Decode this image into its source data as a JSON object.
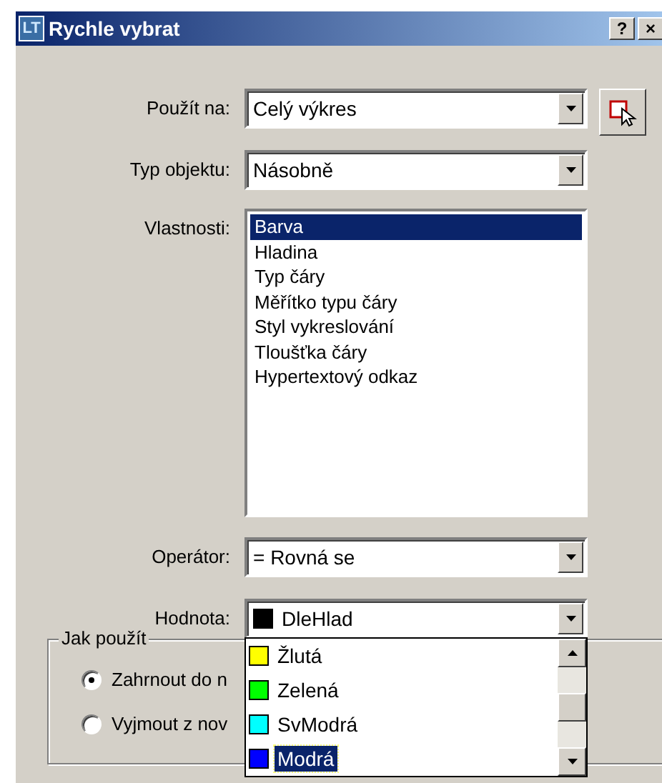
{
  "window": {
    "icon_text": "LT",
    "title": "Rychle vybrat",
    "title_buttons": [
      "?",
      "×"
    ]
  },
  "fields": [
    {
      "kind": "combo",
      "label": "Použít na:",
      "value": "Celý výkres",
      "pick_button": true
    },
    {
      "kind": "combo",
      "label": "Typ objektu:",
      "value": "Násobně"
    },
    {
      "kind": "list",
      "label": "Vlastnosti:",
      "items": [
        {
          "text": "Barva",
          "selected": true
        },
        {
          "text": "Hladina",
          "selected": false
        },
        {
          "text": "Typ čáry",
          "selected": false
        },
        {
          "text": "Měřítko typu čáry",
          "selected": false
        },
        {
          "text": "Styl vykreslování",
          "selected": false
        },
        {
          "text": "Tloušťka čáry",
          "selected": false
        },
        {
          "text": "Hypertextový odkaz",
          "selected": false
        }
      ]
    },
    {
      "kind": "combo",
      "label": "Operátor:",
      "value": "= Rovná se"
    },
    {
      "kind": "color_combo",
      "label": "Hodnota:",
      "value": "DleHlad",
      "color": "#000000",
      "options": [
        {
          "text": "Žlutá",
          "color": "#ffff00",
          "selected": false
        },
        {
          "text": "Zelená",
          "color": "#00ff00",
          "selected": false
        },
        {
          "text": "SvModrá",
          "color": "#00ffff",
          "selected": false
        },
        {
          "text": "Modrá",
          "color": "#0000ff",
          "selected": true
        }
      ]
    }
  ],
  "group": {
    "title": "Jak použít",
    "options": [
      {
        "label": "Zahrnout do n",
        "selected": true
      },
      {
        "label": "Vyjmout z nov",
        "selected": false
      }
    ]
  }
}
